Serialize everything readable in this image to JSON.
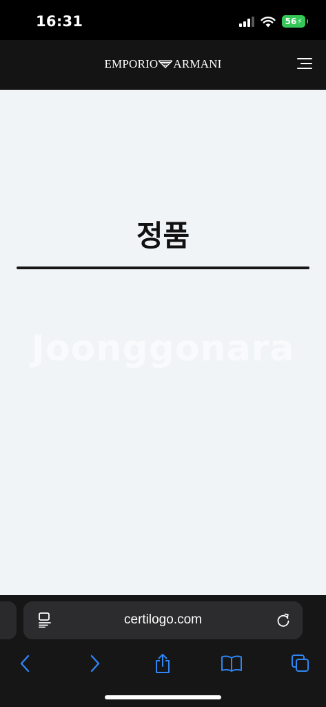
{
  "status_bar": {
    "time": "16:31",
    "battery_level": "56"
  },
  "header": {
    "brand_left": "EMPORIO",
    "brand_right": "ARMANI"
  },
  "content": {
    "heading": "정품",
    "watermark": "Joonggonara"
  },
  "browser": {
    "url": "certilogo.com"
  },
  "colors": {
    "accent": "#2f86f6",
    "battery": "#36c759",
    "page_bg": "#f1f4f7",
    "header_bg": "#141414"
  }
}
